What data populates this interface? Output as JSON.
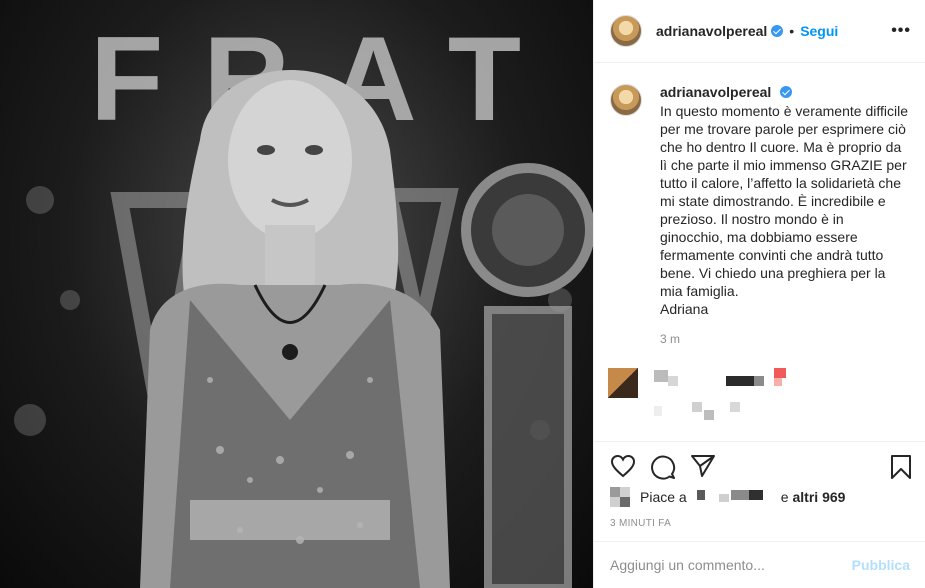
{
  "post": {
    "photo_alt_icon": "photo",
    "photo_sign": "FRAT"
  },
  "header": {
    "username": "adrianavolpereal",
    "dot": "•",
    "follow_label": "Segui",
    "more_label": "•••",
    "verified_color": "#3897f0"
  },
  "caption": {
    "username": "adrianavolpereal",
    "text": "In questo momento è veramente difficile per me trovare parole per esprimere ciò che ho dentro Il cuore. Ma è proprio da lì che parte il mio immenso GRAZIE per tutto il calore, l’affetto la solidarietà che mi state dimostrando. È incredibile e prezioso. Il nostro mondo è in ginocchio, ma dobbiamo essere fermamente convinti che andrà tutto bene. Vi chiedo una preghiera per la mia famiglia.\nAdriana",
    "time": "3 m"
  },
  "actions": {
    "like_icon": "heart-icon",
    "comment_icon": "comment-icon",
    "share_icon": "send-icon",
    "save_icon": "bookmark-icon"
  },
  "likes": {
    "prefix": "Piace a",
    "suffix_and": "e",
    "others": "altri 969"
  },
  "date": "3 MINUTI FA",
  "comment_bar": {
    "placeholder": "Aggiungi un commento...",
    "publish_label": "Pubblica"
  },
  "colors": {
    "link_blue": "#0095f6",
    "publish_disabled": "#b2dffc",
    "muted": "#8e8e8e"
  }
}
